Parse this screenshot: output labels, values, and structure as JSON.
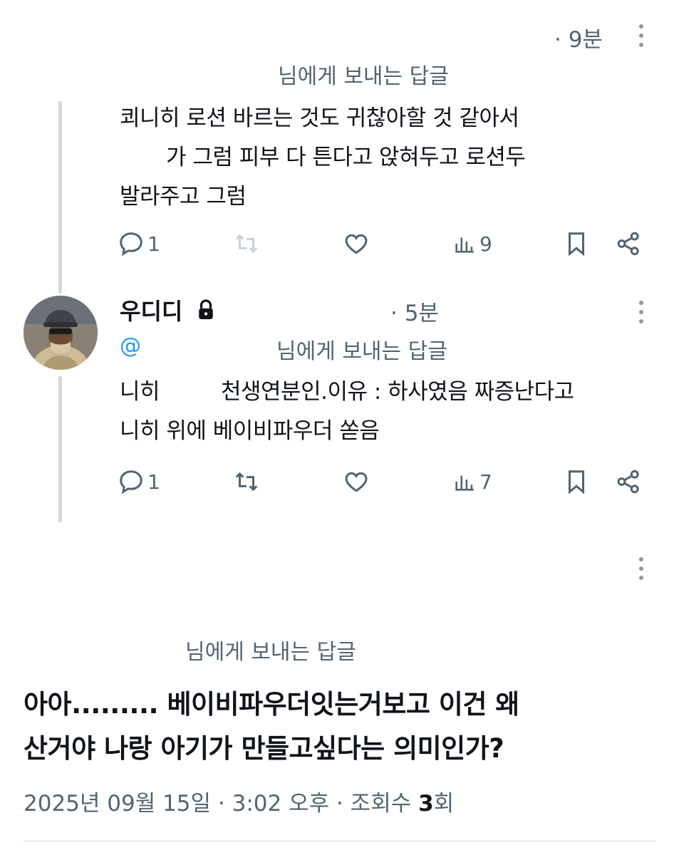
{
  "tweet1": {
    "time": "· 9분",
    "reply_to": "님에게 보내는 답글",
    "lines": [
      "쾨니히 로션 바르는 것도 귀찮아할 것 같아서",
      "가 그럼 피부 다 튼다고 앉혀두고 로션두",
      "발라주고 그럼"
    ],
    "actions": {
      "replies": "1",
      "retweets": "",
      "likes": "",
      "views": "9"
    }
  },
  "tweet2": {
    "display_name": "우디디",
    "time": "· 5분",
    "handle_prefix": "@",
    "reply_to": "님에게 보내는 답글",
    "lines": [
      "니히",
      "천생연분인.이유 : 하사였음 짜증난다고",
      "니히 위에 베이비파우더 쏟음"
    ],
    "actions": {
      "replies": "1",
      "retweets": "",
      "likes": "",
      "views": "7"
    }
  },
  "main": {
    "reply_to": "님에게 보내는 답글",
    "lines": [
      "아아......... 베이비파우더잇는거보고 이건 왜",
      "산거야 나랑 아기가 만들고싶다는 의미인가?"
    ],
    "date": "2025년 09월 15일 · 3:02 오후 · 조회수",
    "views_count": "3",
    "views_unit": "회"
  },
  "icons": {
    "reply": "reply-icon",
    "retweet": "retweet-icon",
    "like": "heart-icon",
    "views": "views-icon",
    "bookmark": "bookmark-icon",
    "share": "share-icon",
    "more": "more-icon",
    "lock": "lock-icon"
  },
  "colors": {
    "muted": "#536471",
    "link": "#1d9bf0",
    "line": "#cfd9de",
    "text": "#0f1419"
  }
}
